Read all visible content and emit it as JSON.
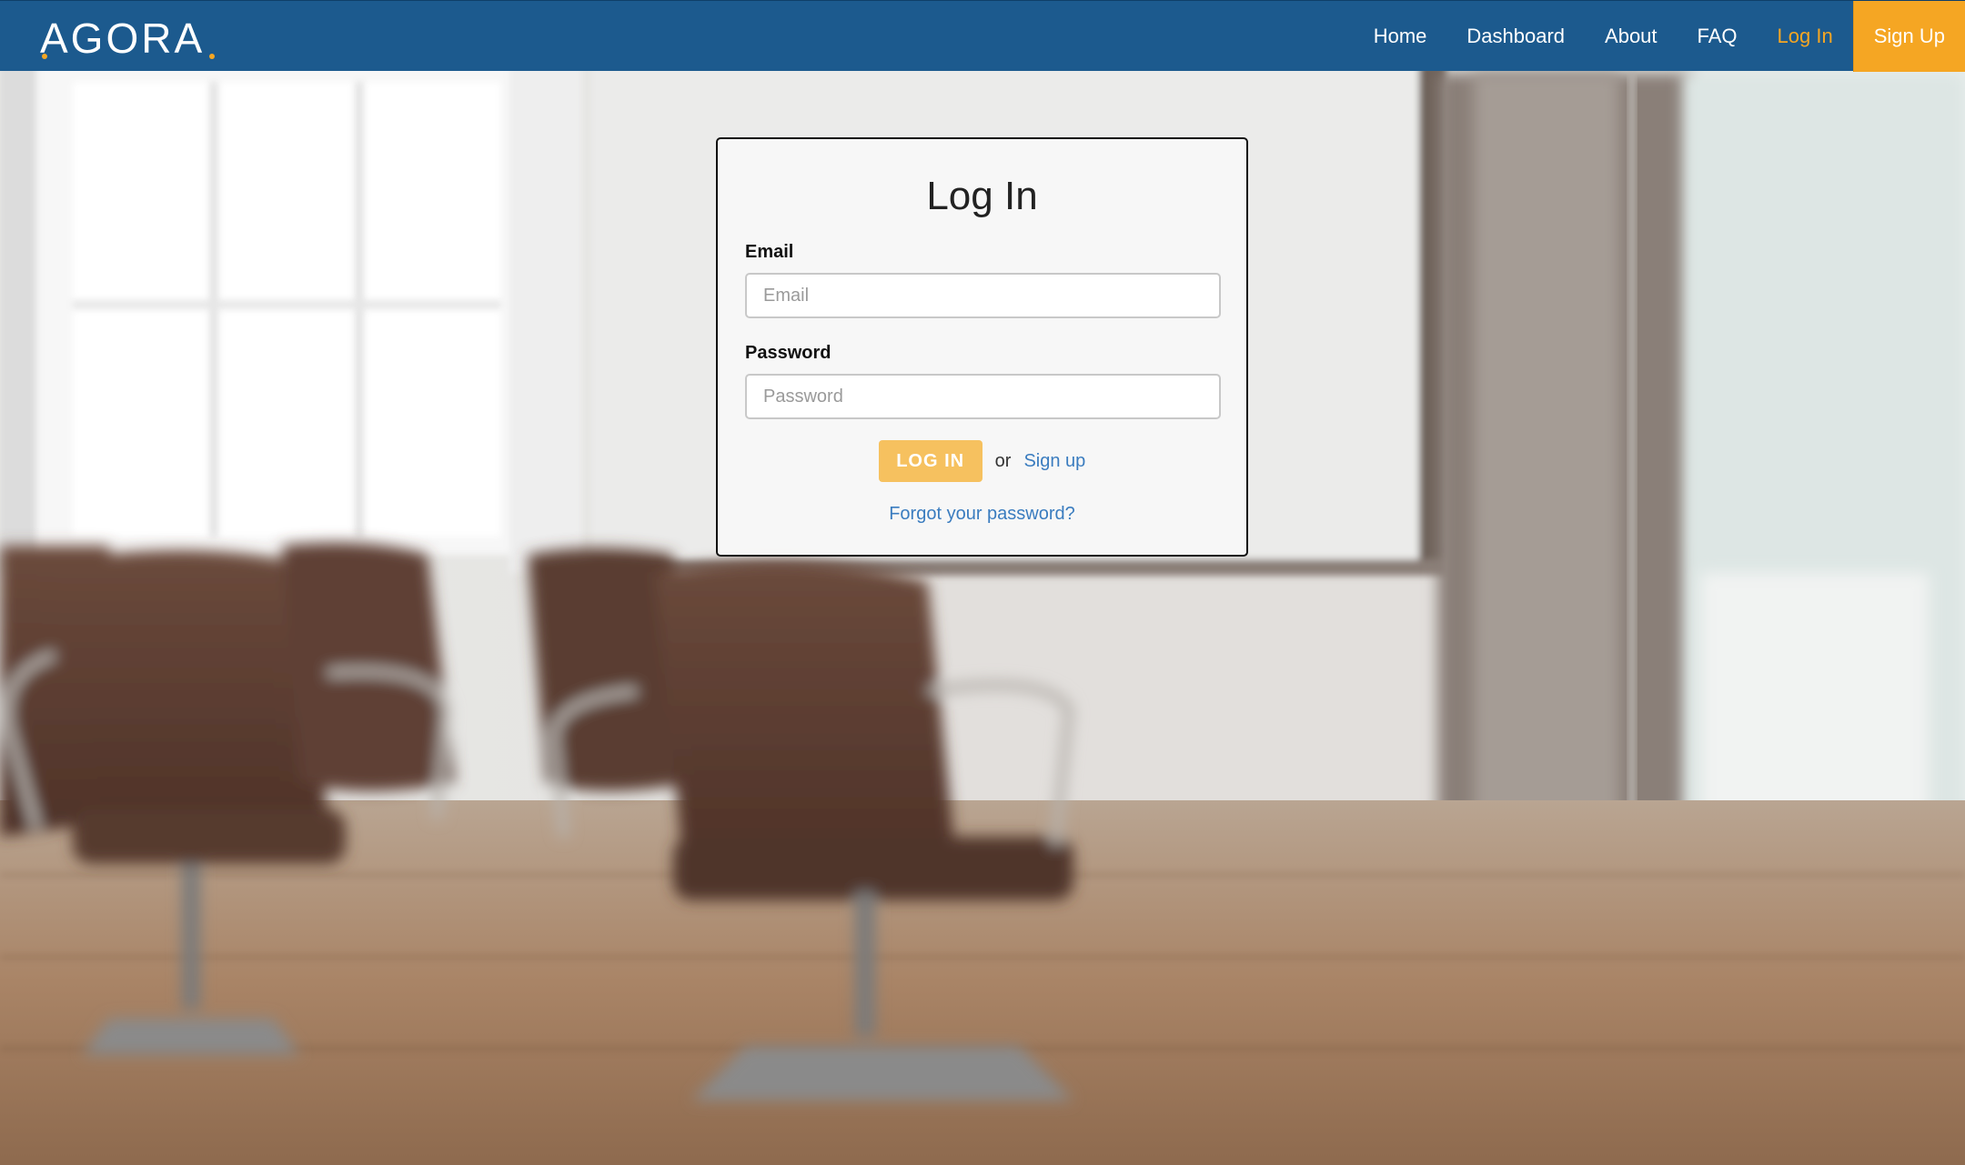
{
  "brand": {
    "name": "AGORA"
  },
  "nav": {
    "items": [
      {
        "label": "Home"
      },
      {
        "label": "Dashboard"
      },
      {
        "label": "About"
      },
      {
        "label": "FAQ"
      },
      {
        "label": "Log In",
        "active": true
      },
      {
        "label": "Sign Up"
      }
    ]
  },
  "login_form": {
    "title": "Log In",
    "email_label": "Email",
    "email_placeholder": "Email",
    "email_value": "",
    "password_label": "Password",
    "password_placeholder": "Password",
    "password_value": "",
    "submit_label": "LOG IN",
    "or_text": "or",
    "signup_link": "Sign up",
    "forgot_link": "Forgot your password?"
  },
  "colors": {
    "navbar_bg": "#1c5a8e",
    "accent": "#f5a623",
    "button_bg": "#f6c15f",
    "link": "#3a7cbf"
  },
  "icons": {
    "background": "conference-room-background-image"
  }
}
